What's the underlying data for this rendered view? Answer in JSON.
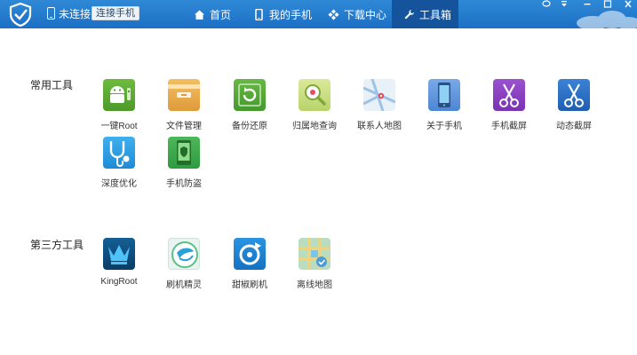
{
  "titlebar": {
    "connection_status": "未连接",
    "connect_button": "连接手机",
    "nav": [
      {
        "label": "首页"
      },
      {
        "label": "我的手机"
      },
      {
        "label": "下载中心"
      },
      {
        "label": "工具箱"
      }
    ],
    "active_nav": "工具箱",
    "window_controls": [
      "feedback-icon",
      "menu-icon",
      "minimize-icon",
      "close-icon"
    ]
  },
  "sections": [
    {
      "title": "常用工具",
      "tools": [
        {
          "label": "一键Root",
          "icon": "android-root-icon",
          "color": "#5aa832"
        },
        {
          "label": "文件管理",
          "icon": "folder-icon",
          "color": "#e9a94a"
        },
        {
          "label": "备份还原",
          "icon": "backup-icon",
          "color": "#55ac37"
        },
        {
          "label": "归属地查询",
          "icon": "location-search-icon",
          "color": "#bcd86a"
        },
        {
          "label": "联系人地图",
          "icon": "contact-map-icon",
          "color": "#cfe0f0"
        },
        {
          "label": "关于手机",
          "icon": "phone-info-icon",
          "color": "#4d8fd6"
        },
        {
          "label": "手机截屏",
          "icon": "scissors-icon",
          "color": "#8a3fc0"
        },
        {
          "label": "动态截屏",
          "icon": "scissors-blue-icon",
          "color": "#2a70c8"
        },
        {
          "label": "深度优化",
          "icon": "stethoscope-icon",
          "color": "#2a9be0"
        },
        {
          "label": "手机防盗",
          "icon": "phone-guard-icon",
          "color": "#3aa84a"
        }
      ]
    },
    {
      "title": "第三方工具",
      "tools": [
        {
          "label": "KingRoot",
          "icon": "kingroot-icon",
          "color": "#0a4f80"
        },
        {
          "label": "刷机精灵",
          "icon": "flash-elf-icon",
          "color": "#3aa3d8"
        },
        {
          "label": "甜椒刷机",
          "icon": "sweet-pepper-icon",
          "color": "#1f86d6"
        },
        {
          "label": "离线地图",
          "icon": "offline-map-icon",
          "color": "#7ac28a"
        }
      ]
    }
  ]
}
